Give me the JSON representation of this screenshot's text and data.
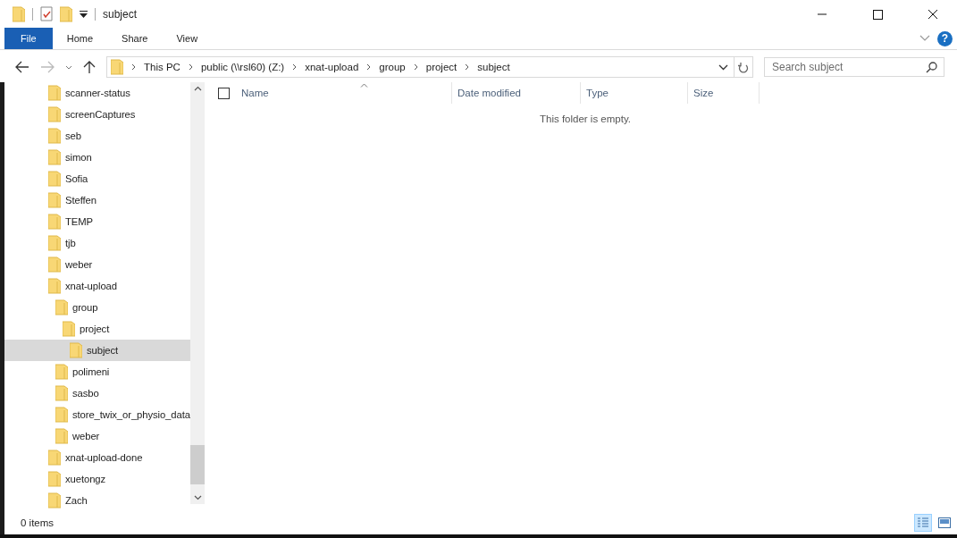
{
  "window": {
    "title": "subject"
  },
  "ribbon_tabs": [
    {
      "label": "File",
      "kind": "file",
      "selected": false
    },
    {
      "label": "Home",
      "kind": "tab",
      "selected": false
    },
    {
      "label": "Share",
      "kind": "tab",
      "selected": false
    },
    {
      "label": "View",
      "kind": "tab",
      "selected": false
    }
  ],
  "address_bar": {
    "segments": [
      "This PC",
      "public (\\\\rsl60) (Z:)",
      "xnat-upload",
      "group",
      "project",
      "subject"
    ]
  },
  "help_button": {
    "label": "?"
  },
  "search": {
    "placeholder": "Search subject"
  },
  "select_all": {
    "checked": false
  },
  "navigation_tree": [
    {
      "label": "scanner-status",
      "selected": false
    },
    {
      "label": "screenCaptures",
      "selected": false
    },
    {
      "label": "seb",
      "selected": false
    },
    {
      "label": "simon",
      "selected": false
    },
    {
      "label": "Sofia",
      "selected": false
    },
    {
      "label": "Steffen",
      "selected": false
    },
    {
      "label": "TEMP",
      "selected": false
    },
    {
      "label": "tjb",
      "selected": false
    },
    {
      "label": "weber",
      "selected": false
    },
    {
      "label": "xnat-upload",
      "selected": false,
      "children": [
        {
          "label": "group",
          "selected": false,
          "children": [
            {
              "label": "project",
              "selected": false,
              "children": [
                {
                  "label": "subject",
                  "selected": true
                }
              ]
            }
          ]
        },
        {
          "label": "polimeni",
          "selected": false
        },
        {
          "label": "sasbo",
          "selected": false
        },
        {
          "label": "store_twix_or_physio_data",
          "selected": false
        },
        {
          "label": "weber",
          "selected": false
        }
      ]
    },
    {
      "label": "xnat-upload-done",
      "selected": false
    },
    {
      "label": "xuetongz",
      "selected": false
    },
    {
      "label": "Zach",
      "selected": false
    }
  ],
  "columns": [
    {
      "label": "Name",
      "sorted": true
    },
    {
      "label": "Date modified",
      "sorted": false
    },
    {
      "label": "Type",
      "sorted": false
    },
    {
      "label": "Size",
      "sorted": false
    }
  ],
  "empty_message": "This folder is empty.",
  "status_bar": {
    "item_count": "0 items",
    "view_buttons": [
      {
        "kind": "details",
        "selected": true
      },
      {
        "kind": "large-icons",
        "selected": false
      }
    ]
  }
}
